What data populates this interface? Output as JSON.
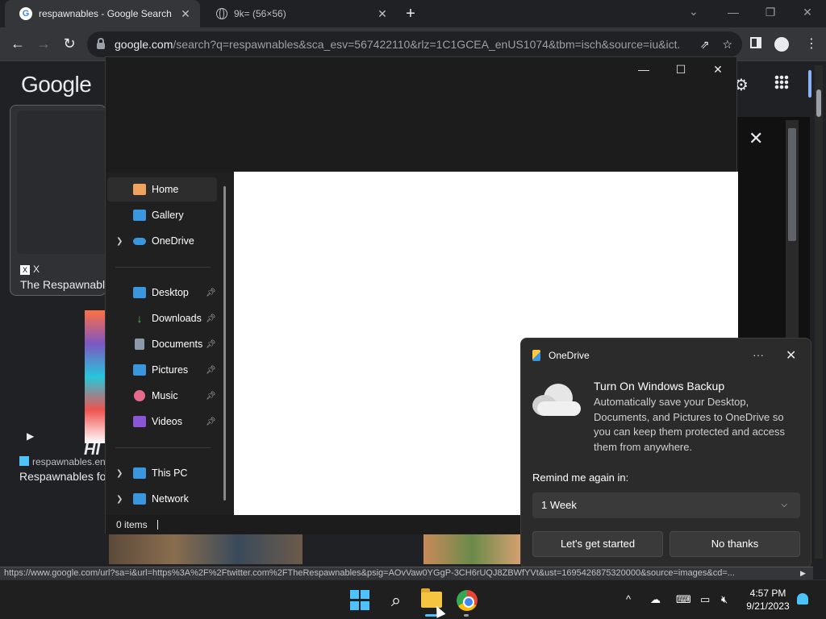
{
  "browser": {
    "tabs": [
      {
        "title": "respawnables - Google Search",
        "active": true,
        "favicon": "google-favicon"
      },
      {
        "title": "9k= (56×56)",
        "active": false,
        "favicon": "globe-icon"
      }
    ],
    "new_tab_label": "+",
    "window_controls": {
      "minimize": "—",
      "restore": "❐",
      "close": "✕"
    },
    "url_host": "google.com",
    "url_rest": "/search?q=respawnables&sca_esv=567422110&rlz=1C1GCEA_enUS1074&tbm=isch&source=iu&ict..."
  },
  "google": {
    "logo": "Google",
    "result1": {
      "source": "X",
      "title": "The Respawnabl"
    },
    "result2": {
      "source": "respawnables.en",
      "title": "Respawnables fo"
    },
    "thumb_text": "HI"
  },
  "explorer": {
    "controls": {
      "minimize": "—",
      "maximize": "☐",
      "close": "✕"
    },
    "nav": [
      {
        "label": "Home",
        "icon": "home-icon",
        "color": "#f0a35e"
      },
      {
        "label": "Gallery",
        "icon": "gallery-icon",
        "color": "#3a96dd"
      },
      {
        "label": "OneDrive",
        "icon": "onedrive-icon",
        "color": "#3a96dd",
        "expandable": true
      },
      {
        "label": "Desktop",
        "icon": "desktop-icon",
        "color": "#3a96dd",
        "pinned": true
      },
      {
        "label": "Downloads",
        "icon": "downloads-icon",
        "color": "#3cbf6a",
        "pinned": true
      },
      {
        "label": "Documents",
        "icon": "documents-icon",
        "color": "#8c9bab",
        "pinned": true
      },
      {
        "label": "Pictures",
        "icon": "pictures-icon",
        "color": "#3a96dd",
        "pinned": true
      },
      {
        "label": "Music",
        "icon": "music-icon",
        "color": "#e66a8a",
        "pinned": true
      },
      {
        "label": "Videos",
        "icon": "videos-icon",
        "color": "#8a56d6",
        "pinned": true
      },
      {
        "label": "This PC",
        "icon": "this-pc-icon",
        "color": "#3a96dd",
        "expandable": true
      },
      {
        "label": "Network",
        "icon": "network-icon",
        "color": "#3a96dd",
        "expandable": true
      }
    ],
    "status": "0 items"
  },
  "onedrive": {
    "app_name": "OneDrive",
    "more": "···",
    "close": "✕",
    "title": "Turn On Windows Backup",
    "body": "Automatically save your Desktop, Documents, and Pictures to OneDrive so you can keep them protected and access them from anywhere.",
    "remind_label": "Remind me again in:",
    "remind_value": "1 Week",
    "primary_button": "Let's get started",
    "secondary_button": "No thanks"
  },
  "status_url": "https://www.google.com/url?sa=i&url=https%3A%2F%2Ftwitter.com%2FTheRespawnables&psig=AOvVaw0YGgP-3CH6rUQJ8ZBWfYVt&ust=1695426875320000&source=images&cd=...",
  "taskbar": {
    "time": "4:57 PM",
    "date": "9/21/2023",
    "tray_up": "^"
  }
}
